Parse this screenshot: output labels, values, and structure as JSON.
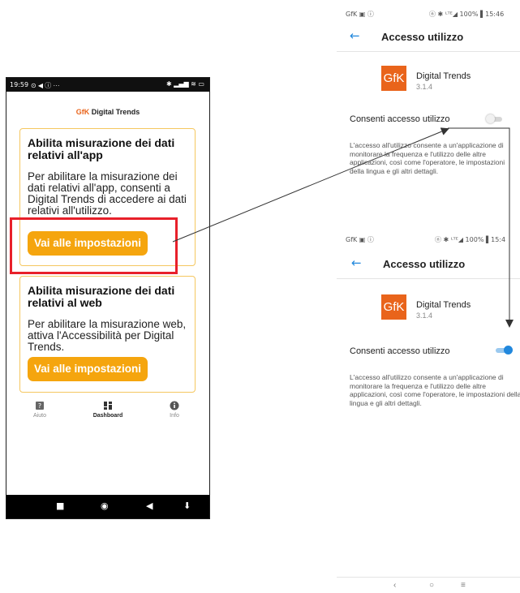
{
  "left_phone": {
    "status_bar": {
      "time": "19:59",
      "left_icons": "⊙ ◀ ⓘ ···",
      "right_icons": "✱ ▂▄▆ ≋ ▭"
    },
    "brand": {
      "gfk": "GfK",
      "name": "Digital Trends"
    },
    "card_app": {
      "title": "Abilita misurazione dei dati relativi all'app",
      "body": "Per abilitare la misurazione dei dati relativi all'app, consenti a Digital Trends di accedere ai dati relativi all'utilizzo.",
      "button": "Vai alle impostazioni"
    },
    "card_web": {
      "title": "Abilita misurazione dei dati relativi al web",
      "body": "Per abilitare la misurazione web, attiva l'Accessibilità per Digital Trends.",
      "button": "Vai alle impostazioni"
    },
    "bottom_nav": [
      {
        "label": "Aiuto",
        "icon": "help-icon"
      },
      {
        "label": "Dashboard",
        "icon": "dashboard-icon",
        "active": true
      },
      {
        "label": "Info",
        "icon": "info-icon"
      }
    ],
    "system_nav": [
      "square-icon",
      "home-circle-icon",
      "back-triangle-icon",
      "down-arrow-icon"
    ]
  },
  "screen_off": {
    "status_left": "GfK ▣ ⓘ",
    "status_right": "ⓝ ✱ ᴸᵀᴱ◢ 100% ▌15:46",
    "title": "Accesso utilizzo",
    "app_name": "Digital Trends",
    "app_version": "3.1.4",
    "setting_label": "Consenti accesso utilizzo",
    "toggle_on": false,
    "description": "L'accesso all'utilizzo consente a un'applicazione di monitorare la frequenza e l'utilizzo delle altre applicazioni, così come l'operatore, le impostazioni della lingua e gli altri dettagli."
  },
  "screen_on": {
    "status_left": "GfK ▣ ⓘ",
    "status_right": "ⓝ ✱ ᴸᵀᴱ◢ 100% ▌15:4",
    "title": "Accesso utilizzo",
    "app_name": "Digital Trends",
    "app_version": "3.1.4",
    "setting_label": "Consenti accesso utilizzo",
    "toggle_on": true,
    "description": "L'accesso all'utilizzo consente a un'applicazione di monitorare la frequenza e l'utilizzo delle altre applicazioni, così come l'operatore, le impostazioni della lingua e gli altri dettagli.",
    "nav": [
      "‹",
      "○",
      "≡"
    ]
  },
  "logo_text": "GfK",
  "colors": {
    "accent_orange": "#f5a50e",
    "gfk_orange": "#e9641b",
    "highlight_red": "#e8202a",
    "toggle_blue": "#2288dd",
    "card_border": "#f5c75f"
  }
}
